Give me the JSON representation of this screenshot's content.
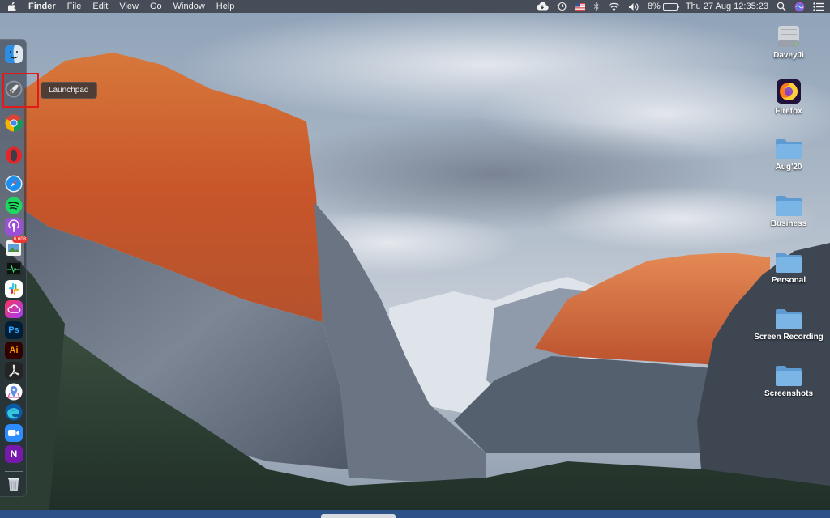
{
  "menubar": {
    "apple_icon": "apple-logo",
    "app_name": "Finder",
    "menus": [
      "File",
      "Edit",
      "View",
      "Go",
      "Window",
      "Help"
    ],
    "status_icons": [
      "creative-cloud-icon",
      "time-machine-icon",
      "us-flag-icon",
      "bluetooth-icon",
      "wifi-icon",
      "volume-icon"
    ],
    "battery_percent_label": "8%",
    "battery_level": 0.08,
    "clock": "Thu 27 Aug  12:35:23",
    "right_icons": [
      "spotlight-icon",
      "siri-icon",
      "notification-center-icon"
    ]
  },
  "dock": {
    "items": [
      {
        "name": "finder",
        "icon": "finder-icon"
      },
      {
        "name": "launchpad",
        "icon": "launchpad-icon"
      },
      {
        "name": "chrome",
        "icon": "chrome-icon"
      },
      {
        "name": "opera",
        "icon": "opera-icon"
      },
      {
        "name": "safari",
        "icon": "safari-icon"
      },
      {
        "name": "spotify",
        "icon": "spotify-icon"
      },
      {
        "name": "podcasts",
        "icon": "podcasts-icon"
      },
      {
        "name": "preview",
        "icon": "preview-icon"
      },
      {
        "name": "activity-monitor",
        "icon": "activity-monitor-icon"
      },
      {
        "name": "slack",
        "icon": "slack-icon"
      },
      {
        "name": "creative-cloud",
        "icon": "creative-cloud-icon"
      },
      {
        "name": "photoshop",
        "icon": "photoshop-icon",
        "text": "Ps"
      },
      {
        "name": "illustrator",
        "icon": "illustrator-icon",
        "text": "Ai"
      },
      {
        "name": "acrobat",
        "icon": "acrobat-icon"
      },
      {
        "name": "maps-app",
        "icon": "maps-icon"
      },
      {
        "name": "edge",
        "icon": "edge-icon"
      },
      {
        "name": "zoom",
        "icon": "zoom-icon"
      },
      {
        "name": "onenote",
        "icon": "onenote-icon",
        "text": "N"
      },
      {
        "name": "trash",
        "icon": "trash-icon"
      }
    ],
    "preview_badge": "6.603",
    "tooltip": "Launchpad",
    "highlight_color": "#e11a1a"
  },
  "desktop": {
    "icons": [
      {
        "label": "DaveyJi",
        "icon": "hard-drive-icon"
      },
      {
        "label": "Firefox",
        "icon": "firefox-icon"
      },
      {
        "label": "Aug'20",
        "icon": "folder-icon"
      },
      {
        "label": "Business",
        "icon": "folder-icon"
      },
      {
        "label": "Personal",
        "icon": "folder-icon"
      },
      {
        "label": "Screen Recording",
        "icon": "folder-icon"
      },
      {
        "label": "Screenshots",
        "icon": "folder-icon"
      }
    ]
  },
  "colors": {
    "menubar_bg": "#3a3e48",
    "folder_blue": "#6fa7d8",
    "bottom_strip": "#2d5289"
  }
}
